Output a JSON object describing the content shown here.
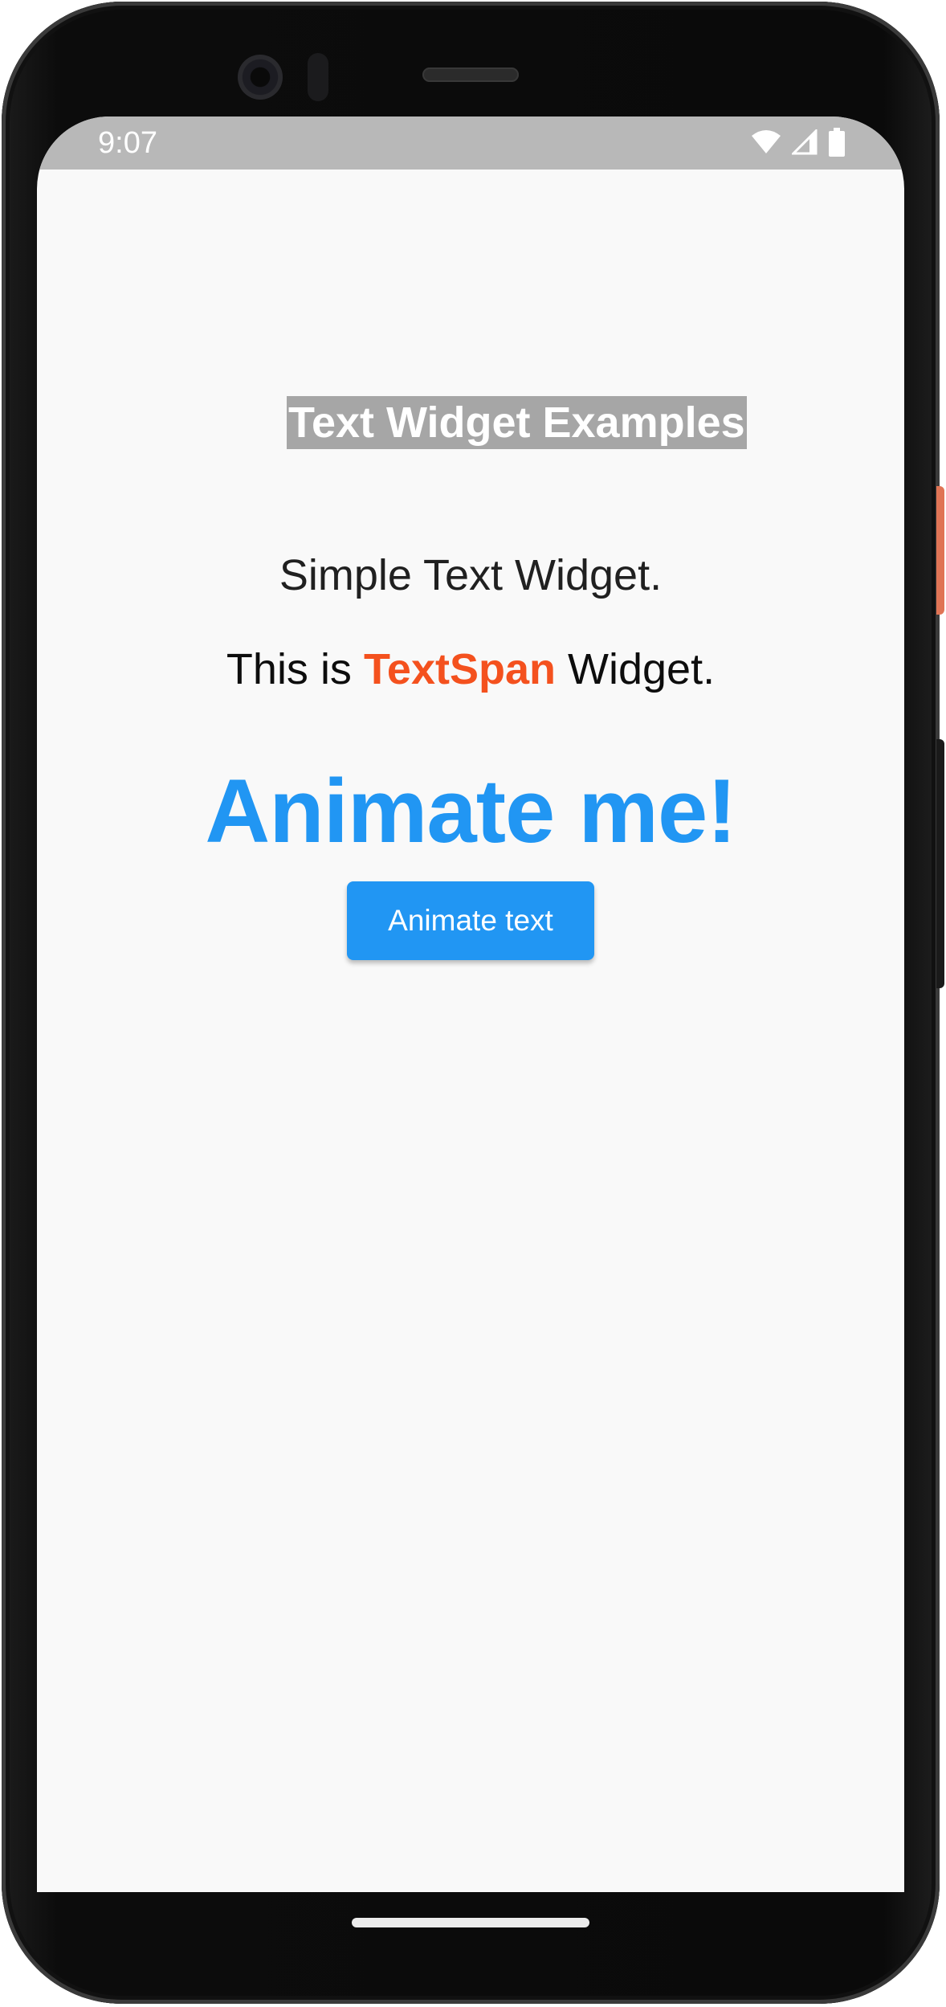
{
  "status_bar": {
    "time": "9:07",
    "icons": [
      "wifi-icon",
      "cellular-signal-icon",
      "battery-icon"
    ]
  },
  "app": {
    "title": "Text Widget Examples",
    "simple_text": "Simple Text Widget.",
    "span_line": {
      "prefix": "This is ",
      "highlight": "TextSpan",
      "suffix": " Widget."
    },
    "animated_text": "Animate me!",
    "button_label": "Animate text"
  },
  "colors": {
    "accent_blue": "#2196f3",
    "accent_orange": "#f4511e",
    "title_background": "#a6a6a6",
    "status_bar": "#b8b8b8",
    "screen_background": "#f9f9f9"
  }
}
